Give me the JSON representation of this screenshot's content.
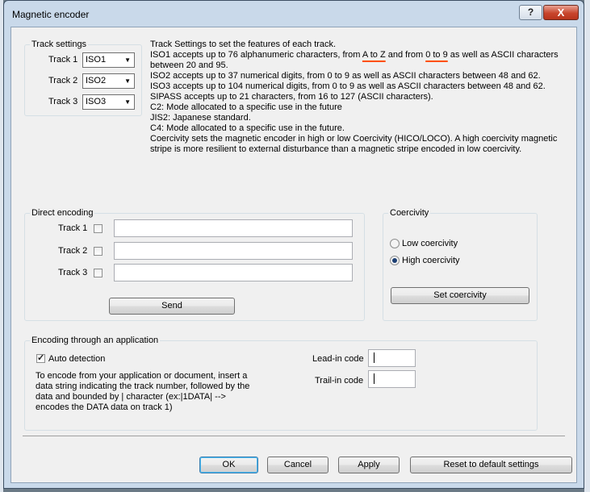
{
  "window": {
    "title": "Magnetic encoder",
    "help_label": "?",
    "close_label": "X"
  },
  "track_settings": {
    "title": "Track settings",
    "tracks": [
      {
        "label": "Track 1",
        "value": "ISO1"
      },
      {
        "label": "Track 2",
        "value": "ISO2"
      },
      {
        "label": "Track 3",
        "value": "ISO3"
      }
    ]
  },
  "info": {
    "line1": "Track Settings to set the features of each track.",
    "line2_a": "ISO1 accepts up to 76 alphanumeric characters, from ",
    "line2_b": "A to Z",
    "line2_c": " and from ",
    "line2_d": "0 to 9",
    "line2_e": " as well as ASCII characters",
    "line3": "between 20 and 95.",
    "line4": "ISO2 accepts up to 37 numerical digits, from 0 to 9 as well as ASCII characters between 48 and 62.",
    "line5": "ISO3 accepts up to 104 numerical digits, from 0 to 9 as well as ASCII characters between 48 and 62.",
    "line6": "SIPASS accepts up to 21 characters, from 16 to 127 (ASCII characters).",
    "line7": "C2: Mode allocated to a specific use in the future",
    "line8": "JIS2: Japanese standard.",
    "line9": "C4: Mode allocated to a specific use in the future.",
    "line10": "Coercivity sets the magnetic encoder in high or low Coercivity (HICO/LOCO). A high coercivity magnetic",
    "line11": "stripe is more resilient to external disturbance than a magnetic stripe encoded in low coercivity."
  },
  "direct_encoding": {
    "title": "Direct encoding",
    "tracks": [
      {
        "label": "Track 1",
        "checked": false,
        "value": ""
      },
      {
        "label": "Track 2",
        "checked": false,
        "value": ""
      },
      {
        "label": "Track 3",
        "checked": false,
        "value": ""
      }
    ],
    "send_label": "Send"
  },
  "coercivity": {
    "title": "Coercivity",
    "low_label": "Low coercivity",
    "high_label": "High coercivity",
    "selected": "high",
    "set_label": "Set coercivity"
  },
  "app_encoding": {
    "title": "Encoding through an application",
    "auto_label": "Auto detection",
    "auto_checked": true,
    "desc1": "To encode from your application or document, insert a",
    "desc2": "data string indicating the track number, followed by the",
    "desc3": "data and bounded by | character (ex:|1DATA| -->",
    "desc4": "encodes the DATA data on track 1)",
    "lead_label": "Lead-in code",
    "lead_value": "",
    "trail_label": "Trail-in code",
    "trail_value": ""
  },
  "buttons": {
    "ok": "OK",
    "cancel": "Cancel",
    "apply": "Apply",
    "reset": "Reset to default settings"
  }
}
